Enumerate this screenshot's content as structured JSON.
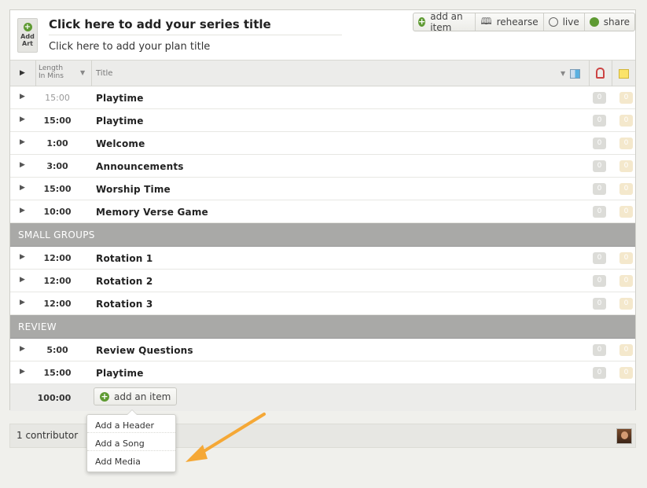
{
  "header": {
    "art_label": "Add Art",
    "series_title": "Click here to add your series title",
    "plan_title": "Click here to add your plan title"
  },
  "toolbar": {
    "add_item": "add an item",
    "rehearse": "rehearse",
    "live": "live",
    "share": "share"
  },
  "columns": {
    "length": "Length In Mins",
    "title": "Title"
  },
  "items": [
    {
      "length": "15:00",
      "title": "Playtime",
      "attachments": "0",
      "notes": "0"
    },
    {
      "length": "15:00",
      "title": "Playtime",
      "attachments": "0",
      "notes": "0"
    },
    {
      "length": "1:00",
      "title": "Welcome",
      "attachments": "0",
      "notes": "0"
    },
    {
      "length": "3:00",
      "title": "Announcements",
      "attachments": "0",
      "notes": "0"
    },
    {
      "length": "15:00",
      "title": "Worship Time",
      "attachments": "0",
      "notes": "0"
    },
    {
      "length": "10:00",
      "title": "Memory Verse Game",
      "attachments": "0",
      "notes": "0"
    },
    {
      "header": "SMALL GROUPS"
    },
    {
      "length": "12:00",
      "title": "Rotation 1",
      "attachments": "0",
      "notes": "0"
    },
    {
      "length": "12:00",
      "title": "Rotation 2",
      "attachments": "0",
      "notes": "0"
    },
    {
      "length": "12:00",
      "title": "Rotation 3",
      "attachments": "0",
      "notes": "0"
    },
    {
      "header": "REVIEW"
    },
    {
      "length": "5:00",
      "title": "Review Questions",
      "attachments": "0",
      "notes": "0"
    },
    {
      "length": "15:00",
      "title": "Playtime",
      "attachments": "0",
      "notes": "0"
    }
  ],
  "footer": {
    "total": "100:00",
    "add_item": "add an item"
  },
  "dropdown": {
    "items": [
      "Add a Header",
      "Add a Song",
      "Add Media"
    ]
  },
  "contributors": {
    "label": "1 contributor"
  },
  "colors": {
    "accent_green": "#5e9a32",
    "section_header": "#a9a9a7",
    "arrow": "#f5a836"
  }
}
